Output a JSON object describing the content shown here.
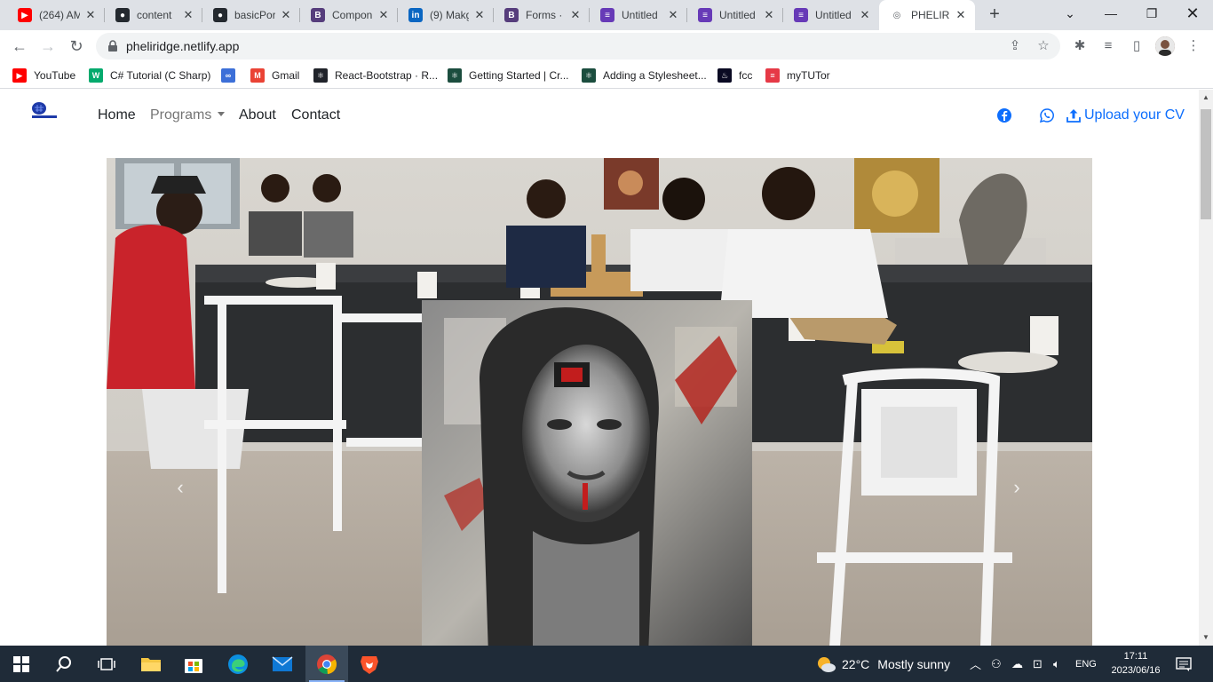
{
  "browser": {
    "tabs": [
      {
        "title": "(264) AM",
        "icon": "youtube-icon",
        "color": "#ff0000"
      },
      {
        "title": "content",
        "icon": "github-icon",
        "color": "#24292f"
      },
      {
        "title": "basicPor",
        "icon": "github-icon",
        "color": "#24292f"
      },
      {
        "title": "Compon",
        "icon": "bootstrap-icon",
        "color": "#563d7c"
      },
      {
        "title": "(9) Makg",
        "icon": "linkedin-icon",
        "color": "#0a66c2"
      },
      {
        "title": "Forms · ",
        "icon": "bootstrap-icon",
        "color": "#563d7c"
      },
      {
        "title": "Untitled",
        "icon": "form-icon",
        "color": "#673ab7"
      },
      {
        "title": "Untitled",
        "icon": "form-icon",
        "color": "#673ab7"
      },
      {
        "title": "Untitled",
        "icon": "form-icon",
        "color": "#673ab7"
      },
      {
        "title": "PHELIRI",
        "icon": "globe-icon",
        "color": "#5f6368",
        "active": true
      }
    ],
    "url": "pheliridge.netlify.app",
    "bookmarks": [
      {
        "label": "YouTube",
        "icon": "youtube-icon",
        "color": "#ff0000"
      },
      {
        "label": "C# Tutorial (C Sharp)",
        "icon": "w3schools-icon",
        "color": "#04aa6d"
      },
      {
        "label": "",
        "icon": "link-icon",
        "color": "#3c6fd8"
      },
      {
        "label": "Gmail",
        "icon": "gmail-icon",
        "color": "#ea4335"
      },
      {
        "label": "React-Bootstrap · R...",
        "icon": "react-bootstrap-icon",
        "color": "#20232a"
      },
      {
        "label": "Getting Started | Cr...",
        "icon": "react-icon",
        "color": "#1b4d3e"
      },
      {
        "label": "Adding a Stylesheet...",
        "icon": "react-icon",
        "color": "#1b4d3e"
      },
      {
        "label": "fcc",
        "icon": "freecodecamp-icon",
        "color": "#0a0a23"
      },
      {
        "label": "myTUTor",
        "icon": "mytutor-icon",
        "color": "#e63946"
      }
    ]
  },
  "site": {
    "nav": {
      "home": "Home",
      "programs": "Programs",
      "about": "About",
      "contact": "Contact",
      "upload_cv": "Upload your CV"
    },
    "colors": {
      "link": "#0d6efd",
      "facebook": "#1877f2",
      "whatsapp": "#0d6efd"
    }
  },
  "taskbar": {
    "weather_temp": "22°C",
    "weather_desc": "Mostly sunny",
    "language": "ENG",
    "time": "17:11",
    "date": "2023/06/16"
  }
}
